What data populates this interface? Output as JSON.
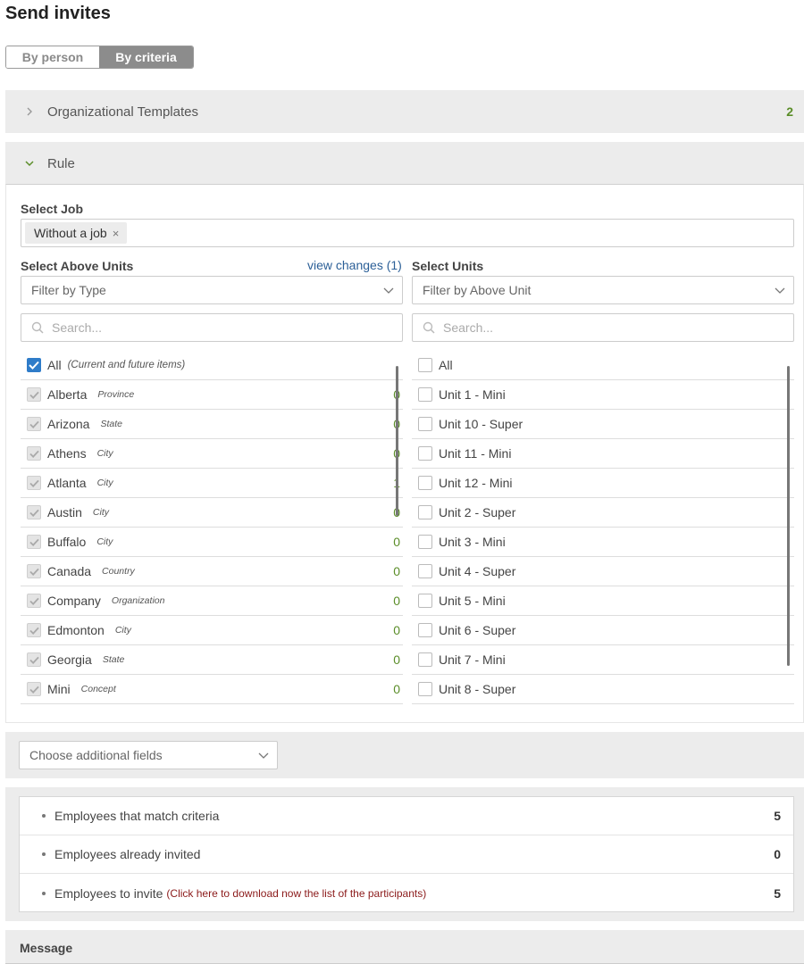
{
  "page": {
    "title": "Send invites",
    "mode_tabs": [
      "By person",
      "By criteria"
    ],
    "active_mode": "By criteria"
  },
  "org_templates": {
    "title": "Organizational Templates",
    "count": "2"
  },
  "rule": {
    "title": "Rule",
    "select_job_label": "Select Job",
    "job_tag": "Without a job",
    "job_tag_remove": "×",
    "above_units": {
      "label": "Select Above Units",
      "view_changes": "view changes (1)",
      "filter_placeholder": "Filter by Type",
      "search_placeholder": "Search...",
      "all_label": "All",
      "all_note": "(Current and future items)",
      "all_checked": true,
      "items": [
        {
          "name": "Alberta",
          "type": "Province",
          "count": "0"
        },
        {
          "name": "Arizona",
          "type": "State",
          "count": "0"
        },
        {
          "name": "Athens",
          "type": "City",
          "count": "0"
        },
        {
          "name": "Atlanta",
          "type": "City",
          "count": "1"
        },
        {
          "name": "Austin",
          "type": "City",
          "count": "0"
        },
        {
          "name": "Buffalo",
          "type": "City",
          "count": "0"
        },
        {
          "name": "Canada",
          "type": "Country",
          "count": "0"
        },
        {
          "name": "Company",
          "type": "Organization",
          "count": "0"
        },
        {
          "name": "Edmonton",
          "type": "City",
          "count": "0"
        },
        {
          "name": "Georgia",
          "type": "State",
          "count": "0"
        },
        {
          "name": "Mini",
          "type": "Concept",
          "count": "0"
        }
      ]
    },
    "units": {
      "label": "Select Units",
      "filter_placeholder": "Filter by Above Unit",
      "search_placeholder": "Search...",
      "all_label": "All",
      "items": [
        "Unit 1 - Mini",
        "Unit 10 - Super",
        "Unit 11 - Mini",
        "Unit 12 - Mini",
        "Unit 2 - Super",
        "Unit 3 - Mini",
        "Unit 4 - Super",
        "Unit 5 - Mini",
        "Unit 6 - Super",
        "Unit 7 - Mini",
        "Unit 8 - Super"
      ]
    }
  },
  "additional_fields": {
    "placeholder": "Choose additional fields"
  },
  "summary": {
    "match_label": "Employees that match criteria",
    "match_value": "5",
    "invited_label": "Employees already invited",
    "invited_value": "0",
    "to_invite_label": "Employees to invite",
    "download_link": "(Click here to download now the list of the participants)",
    "to_invite_value": "5"
  },
  "message": {
    "title": "Message"
  },
  "colors": {
    "accent_blue": "#2f7cc9",
    "count_green": "#5a8d28",
    "link_blue": "#2b5f97",
    "link_red": "#8b1a1a"
  }
}
